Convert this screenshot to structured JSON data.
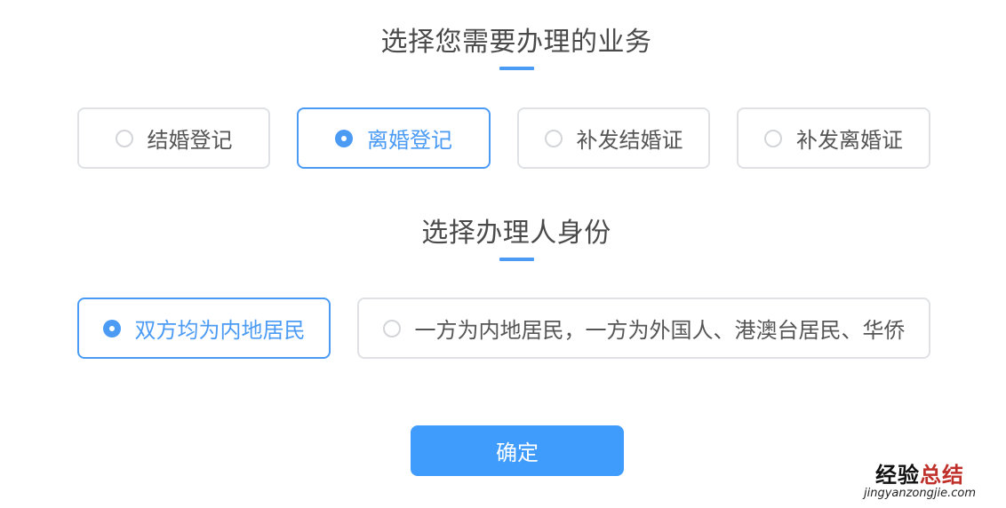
{
  "business_section": {
    "title": "选择您需要办理的业务",
    "options": [
      {
        "label": "结婚登记",
        "selected": false
      },
      {
        "label": "离婚登记",
        "selected": true
      },
      {
        "label": "补发结婚证",
        "selected": false
      },
      {
        "label": "补发离婚证",
        "selected": false
      }
    ]
  },
  "identity_section": {
    "title": "选择办理人身份",
    "options": [
      {
        "label": "双方均为内地居民",
        "selected": true
      },
      {
        "label": "一方为内地居民，一方为外国人、港澳台居民、华侨",
        "selected": false
      }
    ]
  },
  "confirm_button": {
    "label": "确定"
  },
  "watermark": {
    "text_part1": "经验",
    "text_part2": "总结",
    "url": "jingyanzongjie.com"
  },
  "colors": {
    "accent": "#4b9bf5",
    "button": "#409cfc",
    "border": "#dfe1e4",
    "watermark_accent": "#c0302a"
  }
}
